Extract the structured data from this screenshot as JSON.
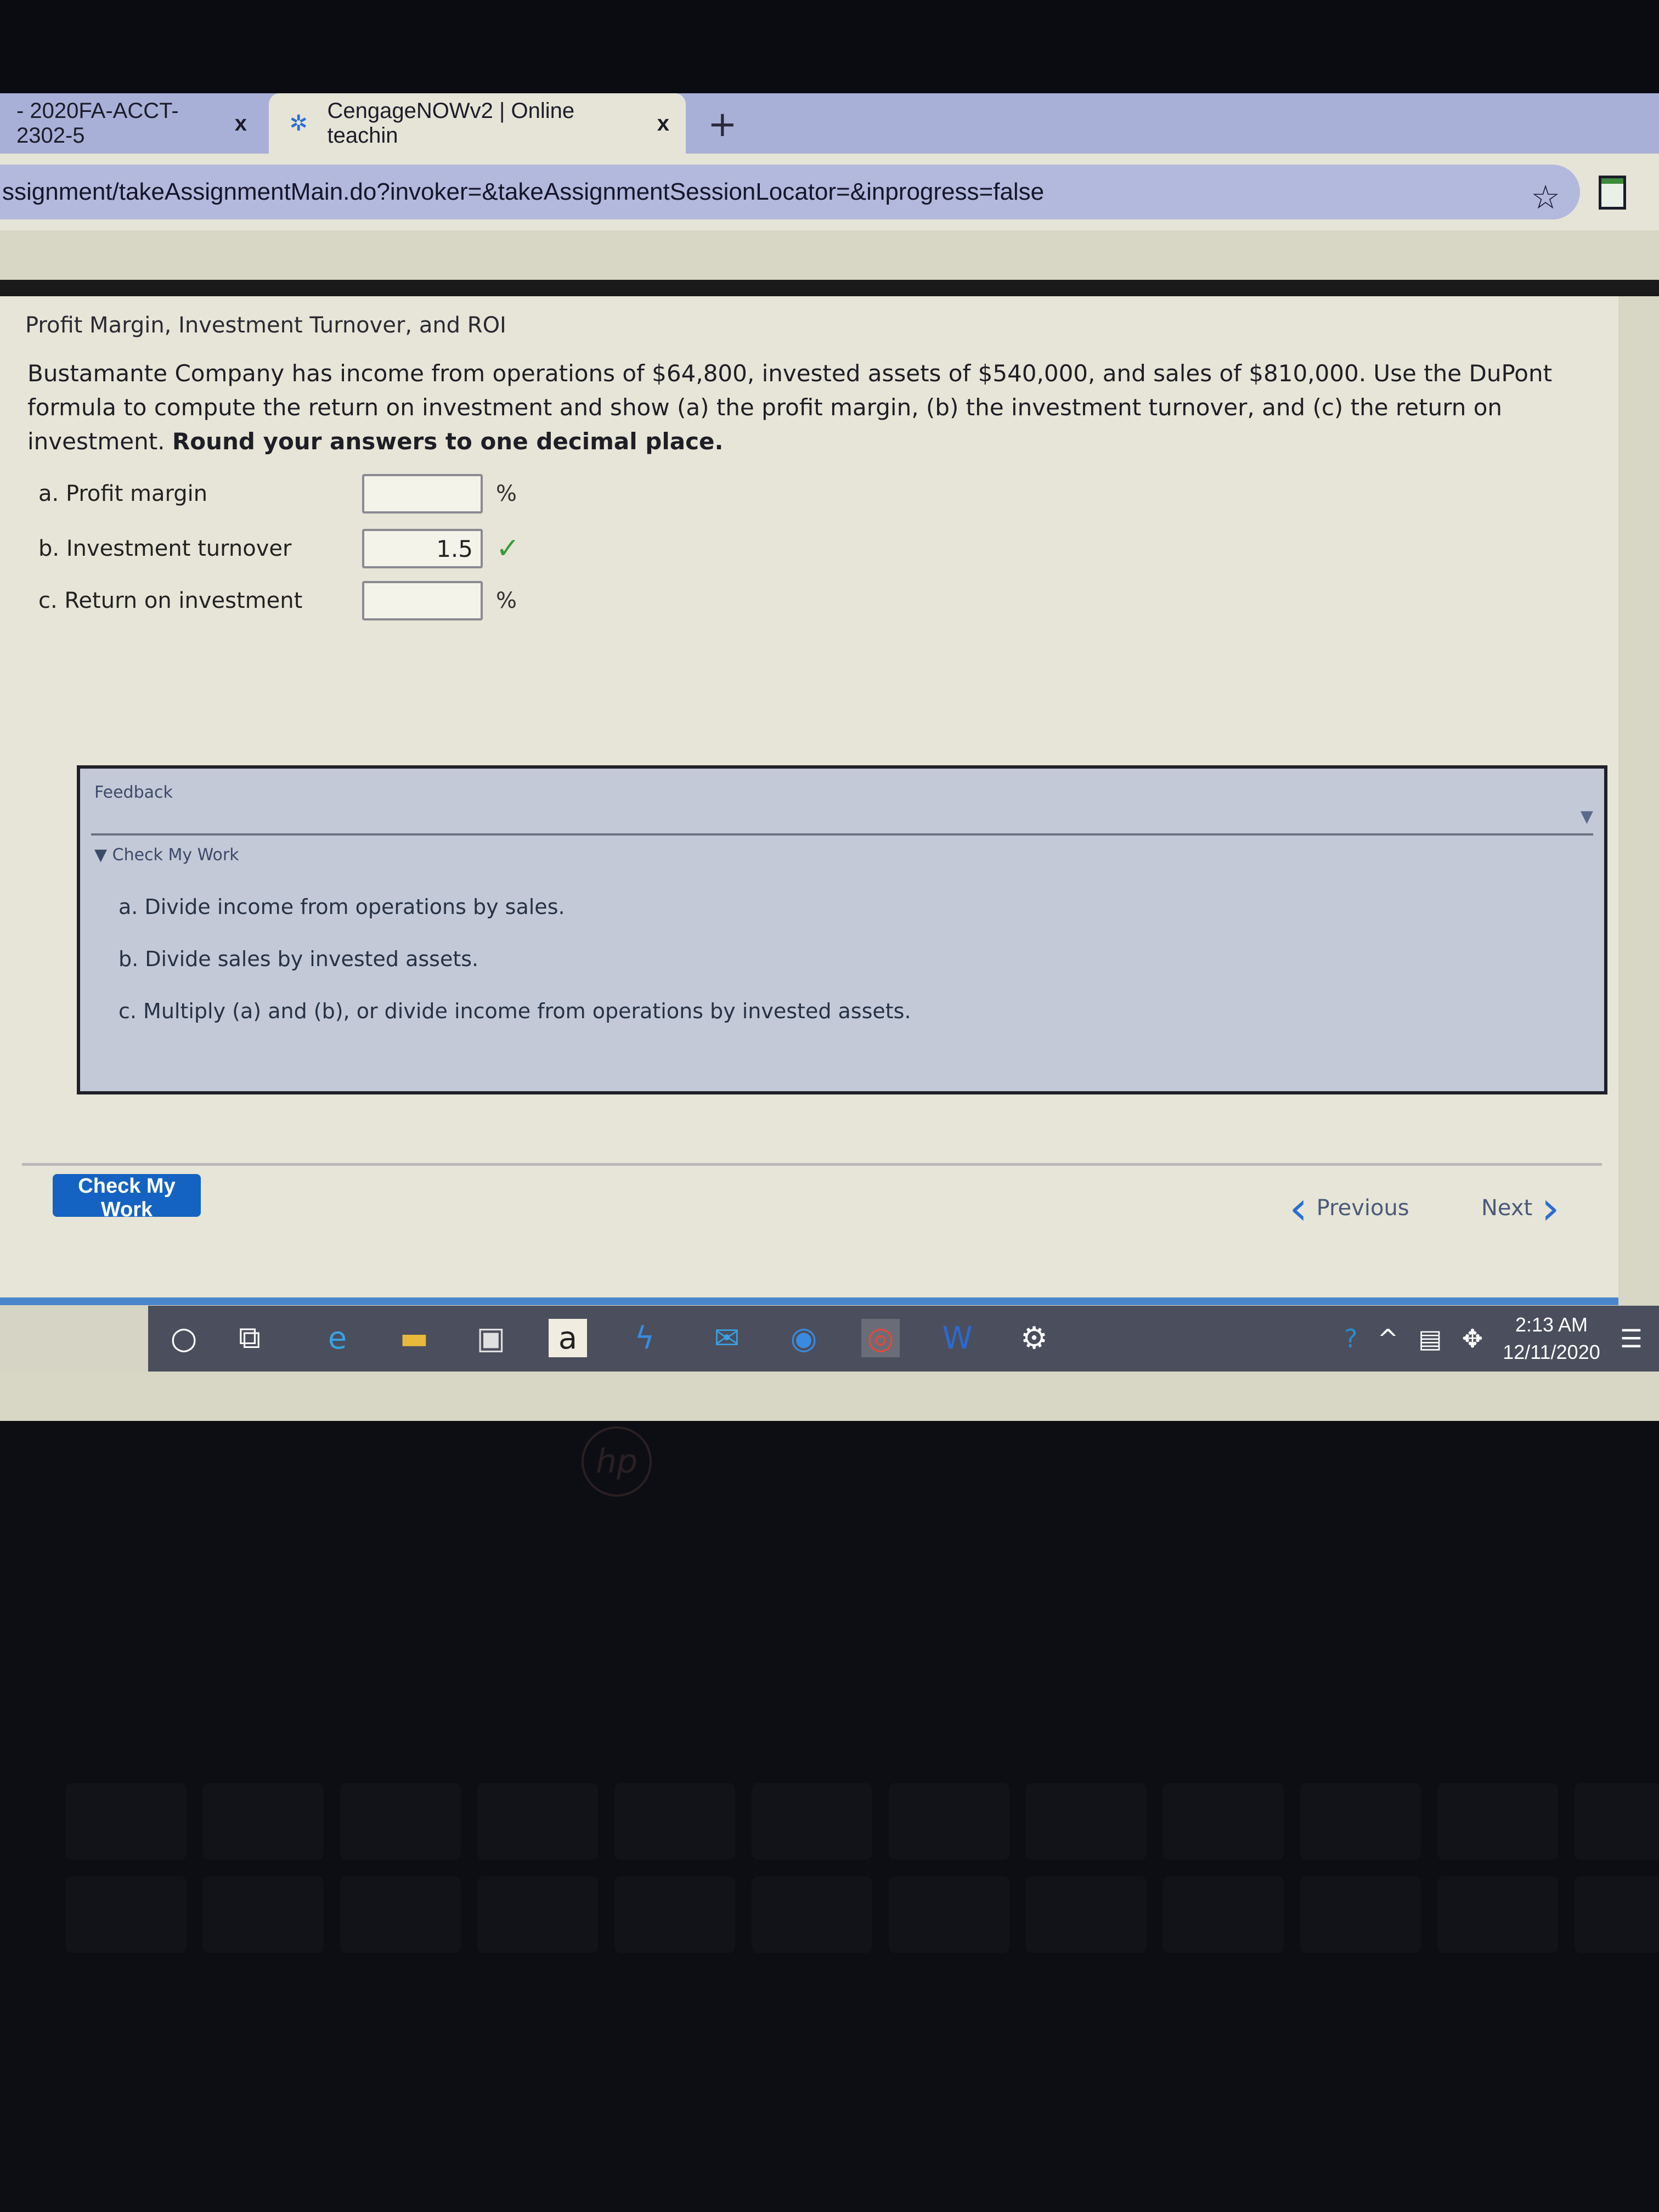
{
  "browser": {
    "tabs": [
      {
        "label": "- 2020FA-ACCT-2302-5",
        "active": false
      },
      {
        "label": "CengageNOWv2 | Online teachin",
        "active": true
      }
    ],
    "new_tab_icon": "plus-icon",
    "close_icon_glyph": "x",
    "address": "ssignment/takeAssignmentMain.do?invoker=&takeAssignmentSessionLocator=&inprogress=false",
    "bookmark_icon": "star-icon",
    "extension_icon": "extension-icon"
  },
  "page": {
    "title": "Profit Margin, Investment Turnover, and ROI",
    "question_text": "Bustamante Company has income from operations of $64,800, invested assets of $540,000, and sales of $810,000. Use the DuPont formula to compute the return on investment and show (a) the profit margin, (b) the investment turnover, and (c) the return on investment.",
    "question_instruction": "Round your answers to one decimal place.",
    "answers": [
      {
        "label": "a.  Profit margin",
        "value": "",
        "unit": "%",
        "status": ""
      },
      {
        "label": "b.  Investment turnover",
        "value": "1.5",
        "unit": "",
        "status": "correct"
      },
      {
        "label": "c.  Return on investment",
        "value": "",
        "unit": "%",
        "status": ""
      }
    ],
    "feedback": {
      "header": "Feedback",
      "section_title": "Check My Work",
      "hints": [
        "a. Divide income from operations by sales.",
        "b. Divide sales by invested assets.",
        "c. Multiply (a) and (b), or divide income from operations by invested assets."
      ]
    },
    "check_my_work_button": "Check My Work",
    "previous_label": "Previous",
    "next_label": "Next"
  },
  "taskbar": {
    "icons": [
      "cortana-search-icon",
      "task-view-icon",
      "internet-explorer-icon",
      "file-explorer-icon",
      "microsoft-store-icon",
      "amazon-icon",
      "bolt-app-icon",
      "mail-icon",
      "cortana-app-icon",
      "chrome-icon",
      "word-icon",
      "settings-icon"
    ],
    "tray_icons": [
      "help-icon",
      "show-hidden-icons-chevron",
      "network-icon",
      "dropbox-icon"
    ],
    "time": "2:13 AM",
    "date": "12/11/2020"
  },
  "colors": {
    "accent_blue": "#1463c2",
    "correct_green": "#3a9a3a",
    "feedback_bg": "#c3c9d6"
  }
}
